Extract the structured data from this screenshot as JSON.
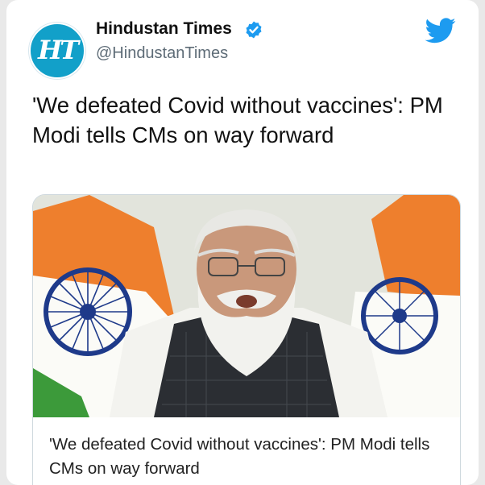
{
  "tweet": {
    "author": {
      "display_name": "Hindustan Times",
      "handle": "@HindustanTimes",
      "avatar_text": "HT",
      "verified": true
    },
    "text": "'We defeated Covid without vaccines': PM Modi tells CMs on way forward",
    "link_card": {
      "title": "'We defeated Covid without vaccines': PM Modi tells CMs on way forward"
    }
  },
  "icons": {
    "platform": "twitter-bird-icon",
    "verified": "verified-badge-icon"
  },
  "colors": {
    "twitter_blue": "#1d9bf0",
    "avatar_bg": "#12a0c9",
    "handle_gray": "#5e6c77",
    "card_border": "#cfd9de"
  }
}
